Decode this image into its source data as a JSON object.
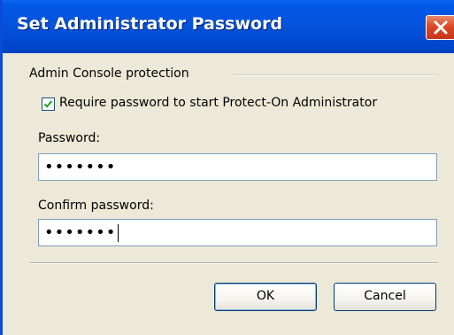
{
  "dialog": {
    "title": "Set Administrator Password",
    "group_label": "Admin Console protection",
    "checkbox": {
      "label": "Require password to start Protect-On Administrator",
      "checked": true
    },
    "password": {
      "label": "Password:",
      "value": "•••••••"
    },
    "confirm_password": {
      "label": "Confirm password:",
      "value": "•••••••"
    },
    "buttons": {
      "ok": "OK",
      "cancel": "Cancel"
    }
  },
  "icons": {
    "close": "close-icon",
    "check": "checkmark-icon"
  },
  "colors": {
    "titlebar": "#0553dd",
    "window_bg": "#ece9d8",
    "close_button": "#d94a24",
    "check": "#21a121"
  }
}
